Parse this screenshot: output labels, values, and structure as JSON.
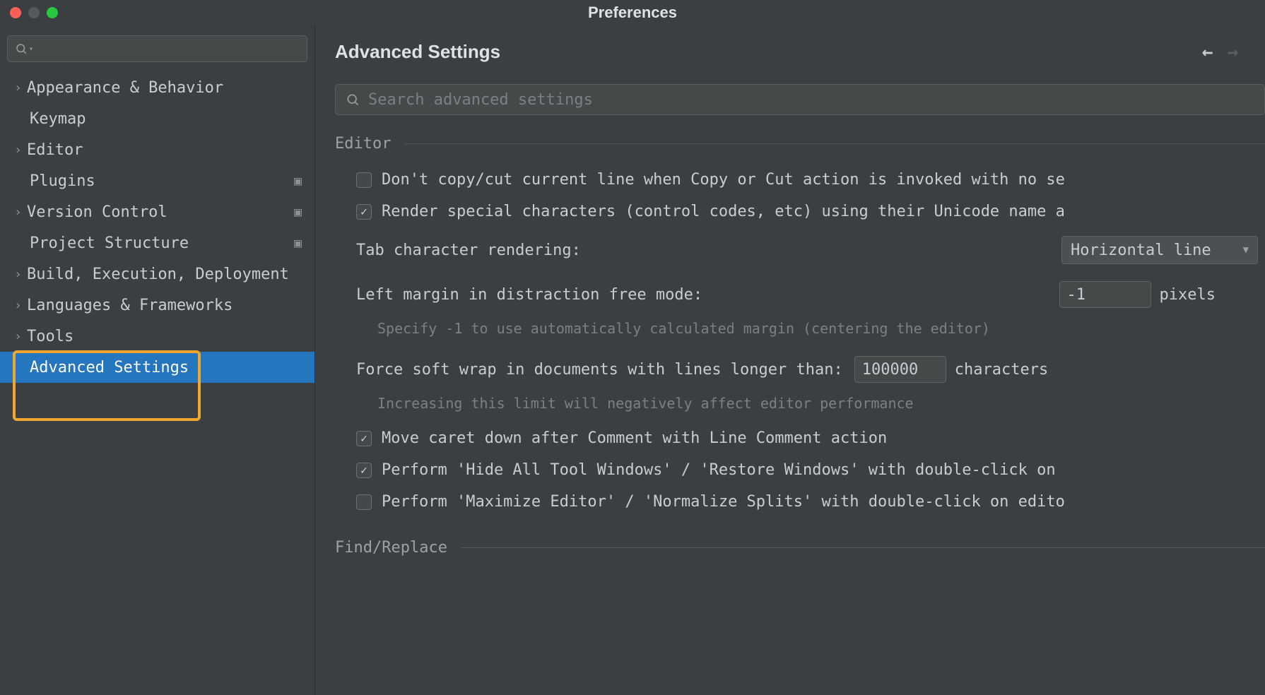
{
  "window": {
    "title": "Preferences"
  },
  "sidebar": {
    "items": [
      {
        "label": "Appearance & Behavior",
        "chev": true,
        "ctx": false
      },
      {
        "label": "Keymap",
        "chev": false,
        "ctx": false
      },
      {
        "label": "Editor",
        "chev": true,
        "ctx": false
      },
      {
        "label": "Plugins",
        "chev": false,
        "ctx": true
      },
      {
        "label": "Version Control",
        "chev": true,
        "ctx": true
      },
      {
        "label": "Project Structure",
        "chev": false,
        "ctx": true
      },
      {
        "label": "Build, Execution, Deployment",
        "chev": true,
        "ctx": false
      },
      {
        "label": "Languages & Frameworks",
        "chev": true,
        "ctx": false
      },
      {
        "label": "Tools",
        "chev": true,
        "ctx": false
      },
      {
        "label": "Advanced Settings",
        "chev": false,
        "ctx": false
      }
    ]
  },
  "main": {
    "heading": "Advanced Settings",
    "search_placeholder": "Search advanced settings",
    "sections": {
      "editor": {
        "title": "Editor",
        "opt_dont_copy": "Don't copy/cut current line when Copy or Cut action is invoked with no se",
        "opt_render_special": "Render special characters (control codes, etc) using their Unicode name a",
        "tab_rendering_label": "Tab character rendering:",
        "tab_rendering_value": "Horizontal line",
        "left_margin_label": "Left margin in distraction free mode:",
        "left_margin_value": "-1",
        "left_margin_unit": "pixels",
        "left_margin_help": "Specify -1 to use automatically calculated margin (centering the editor)",
        "soft_wrap_label": "Force soft wrap in documents with lines longer than:",
        "soft_wrap_value": "100000",
        "soft_wrap_unit": "characters",
        "soft_wrap_help": "Increasing this limit will negatively affect editor performance",
        "opt_move_caret": "Move caret down after Comment with Line Comment action",
        "opt_hide_tool": "Perform 'Hide All Tool Windows' / 'Restore Windows' with double-click on ",
        "opt_maximize": "Perform 'Maximize Editor' / 'Normalize Splits' with double-click on edito"
      },
      "find_replace": {
        "title": "Find/Replace"
      }
    }
  }
}
